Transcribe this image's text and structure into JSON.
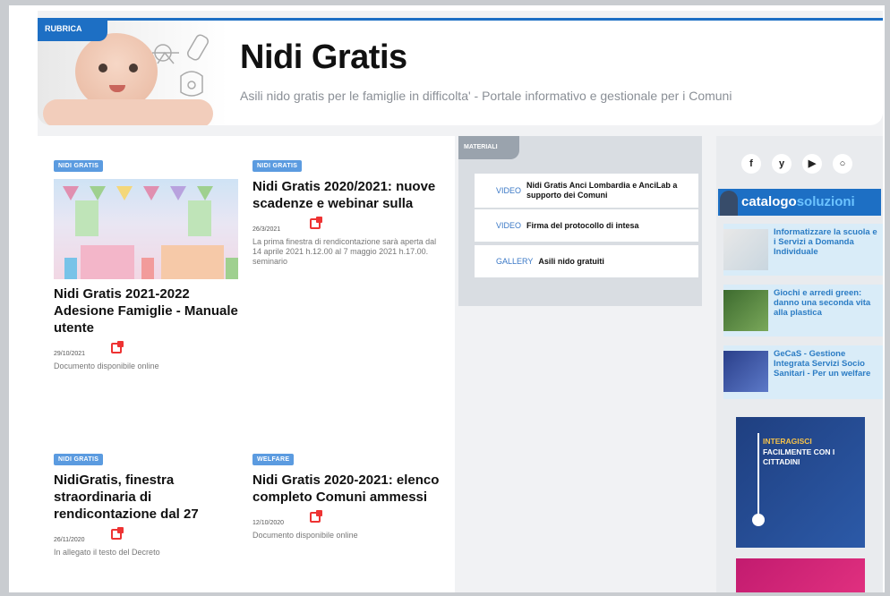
{
  "header": {
    "rubrica_label": "RUBRICA",
    "title": "Nidi Gratis",
    "subtitle": "Asili nido gratis per le famiglie in difficolta' - Portale informativo e gestionale per i Comuni"
  },
  "articles": [
    {
      "tag": "NIDI GRATIS",
      "title": "Nidi Gratis 2021-2022 Adesione Famiglie - Manuale utente",
      "date": "29/10/2021",
      "description": "Documento disponibile online"
    },
    {
      "tag": "NIDI GRATIS",
      "title": "Nidi Gratis 2020/2021: nuove scadenze e webinar sulla",
      "date": "26/3/2021",
      "description": "La prima finestra di rendicontazione sarà aperta dal 14 aprile 2021 h.12.00 al 7 maggio 2021 h.17.00. seminario"
    },
    {
      "tag": "NIDI GRATIS",
      "title": "NidiGratis, finestra straordinaria di rendicontazione dal 27",
      "date": "26/11/2020",
      "description": "In allegato il testo del Decreto"
    },
    {
      "tag": "WELFARE",
      "title": "Nidi Gratis 2020-2021: elenco completo Comuni ammessi",
      "date": "12/10/2020",
      "description": "Documento disponibile online"
    }
  ],
  "materiali": {
    "label": "MATERIALI",
    "items": [
      {
        "kind": "VIDEO",
        "title": "Nidi Gratis Anci Lombardia e AnciLab a supporto dei Comuni"
      },
      {
        "kind": "VIDEO",
        "title": "Firma del protocollo di intesa"
      },
      {
        "kind": "GALLERY",
        "title": "Asili nido gratuiti"
      }
    ]
  },
  "sidebar": {
    "social": [
      {
        "icon": "facebook-icon",
        "glyph": "f"
      },
      {
        "icon": "twitter-icon",
        "glyph": "y"
      },
      {
        "icon": "youtube-icon",
        "glyph": "▶"
      },
      {
        "icon": "rss-icon",
        "glyph": "○"
      }
    ],
    "catalogo_part1": "catalogo",
    "catalogo_part2": "soluzioni",
    "items": [
      {
        "text": "Informatizzare la scuola e i Servizi a Domanda Individuale"
      },
      {
        "text": "Giochi e arredi green: danno una seconda vita alla plastica"
      },
      {
        "text": "GeCaS - Gestione Integrata Servizi Socio Sanitari - Per un welfare"
      }
    ],
    "ad": {
      "line1": "INTERAGISCI",
      "line2": "FACILMENTE CON I CITTADINI"
    }
  },
  "colors": {
    "accent": "#1d6fc4",
    "tag": "#5b9be0",
    "share": "#ee3333",
    "sidebar_link": "#2b7cc4"
  }
}
